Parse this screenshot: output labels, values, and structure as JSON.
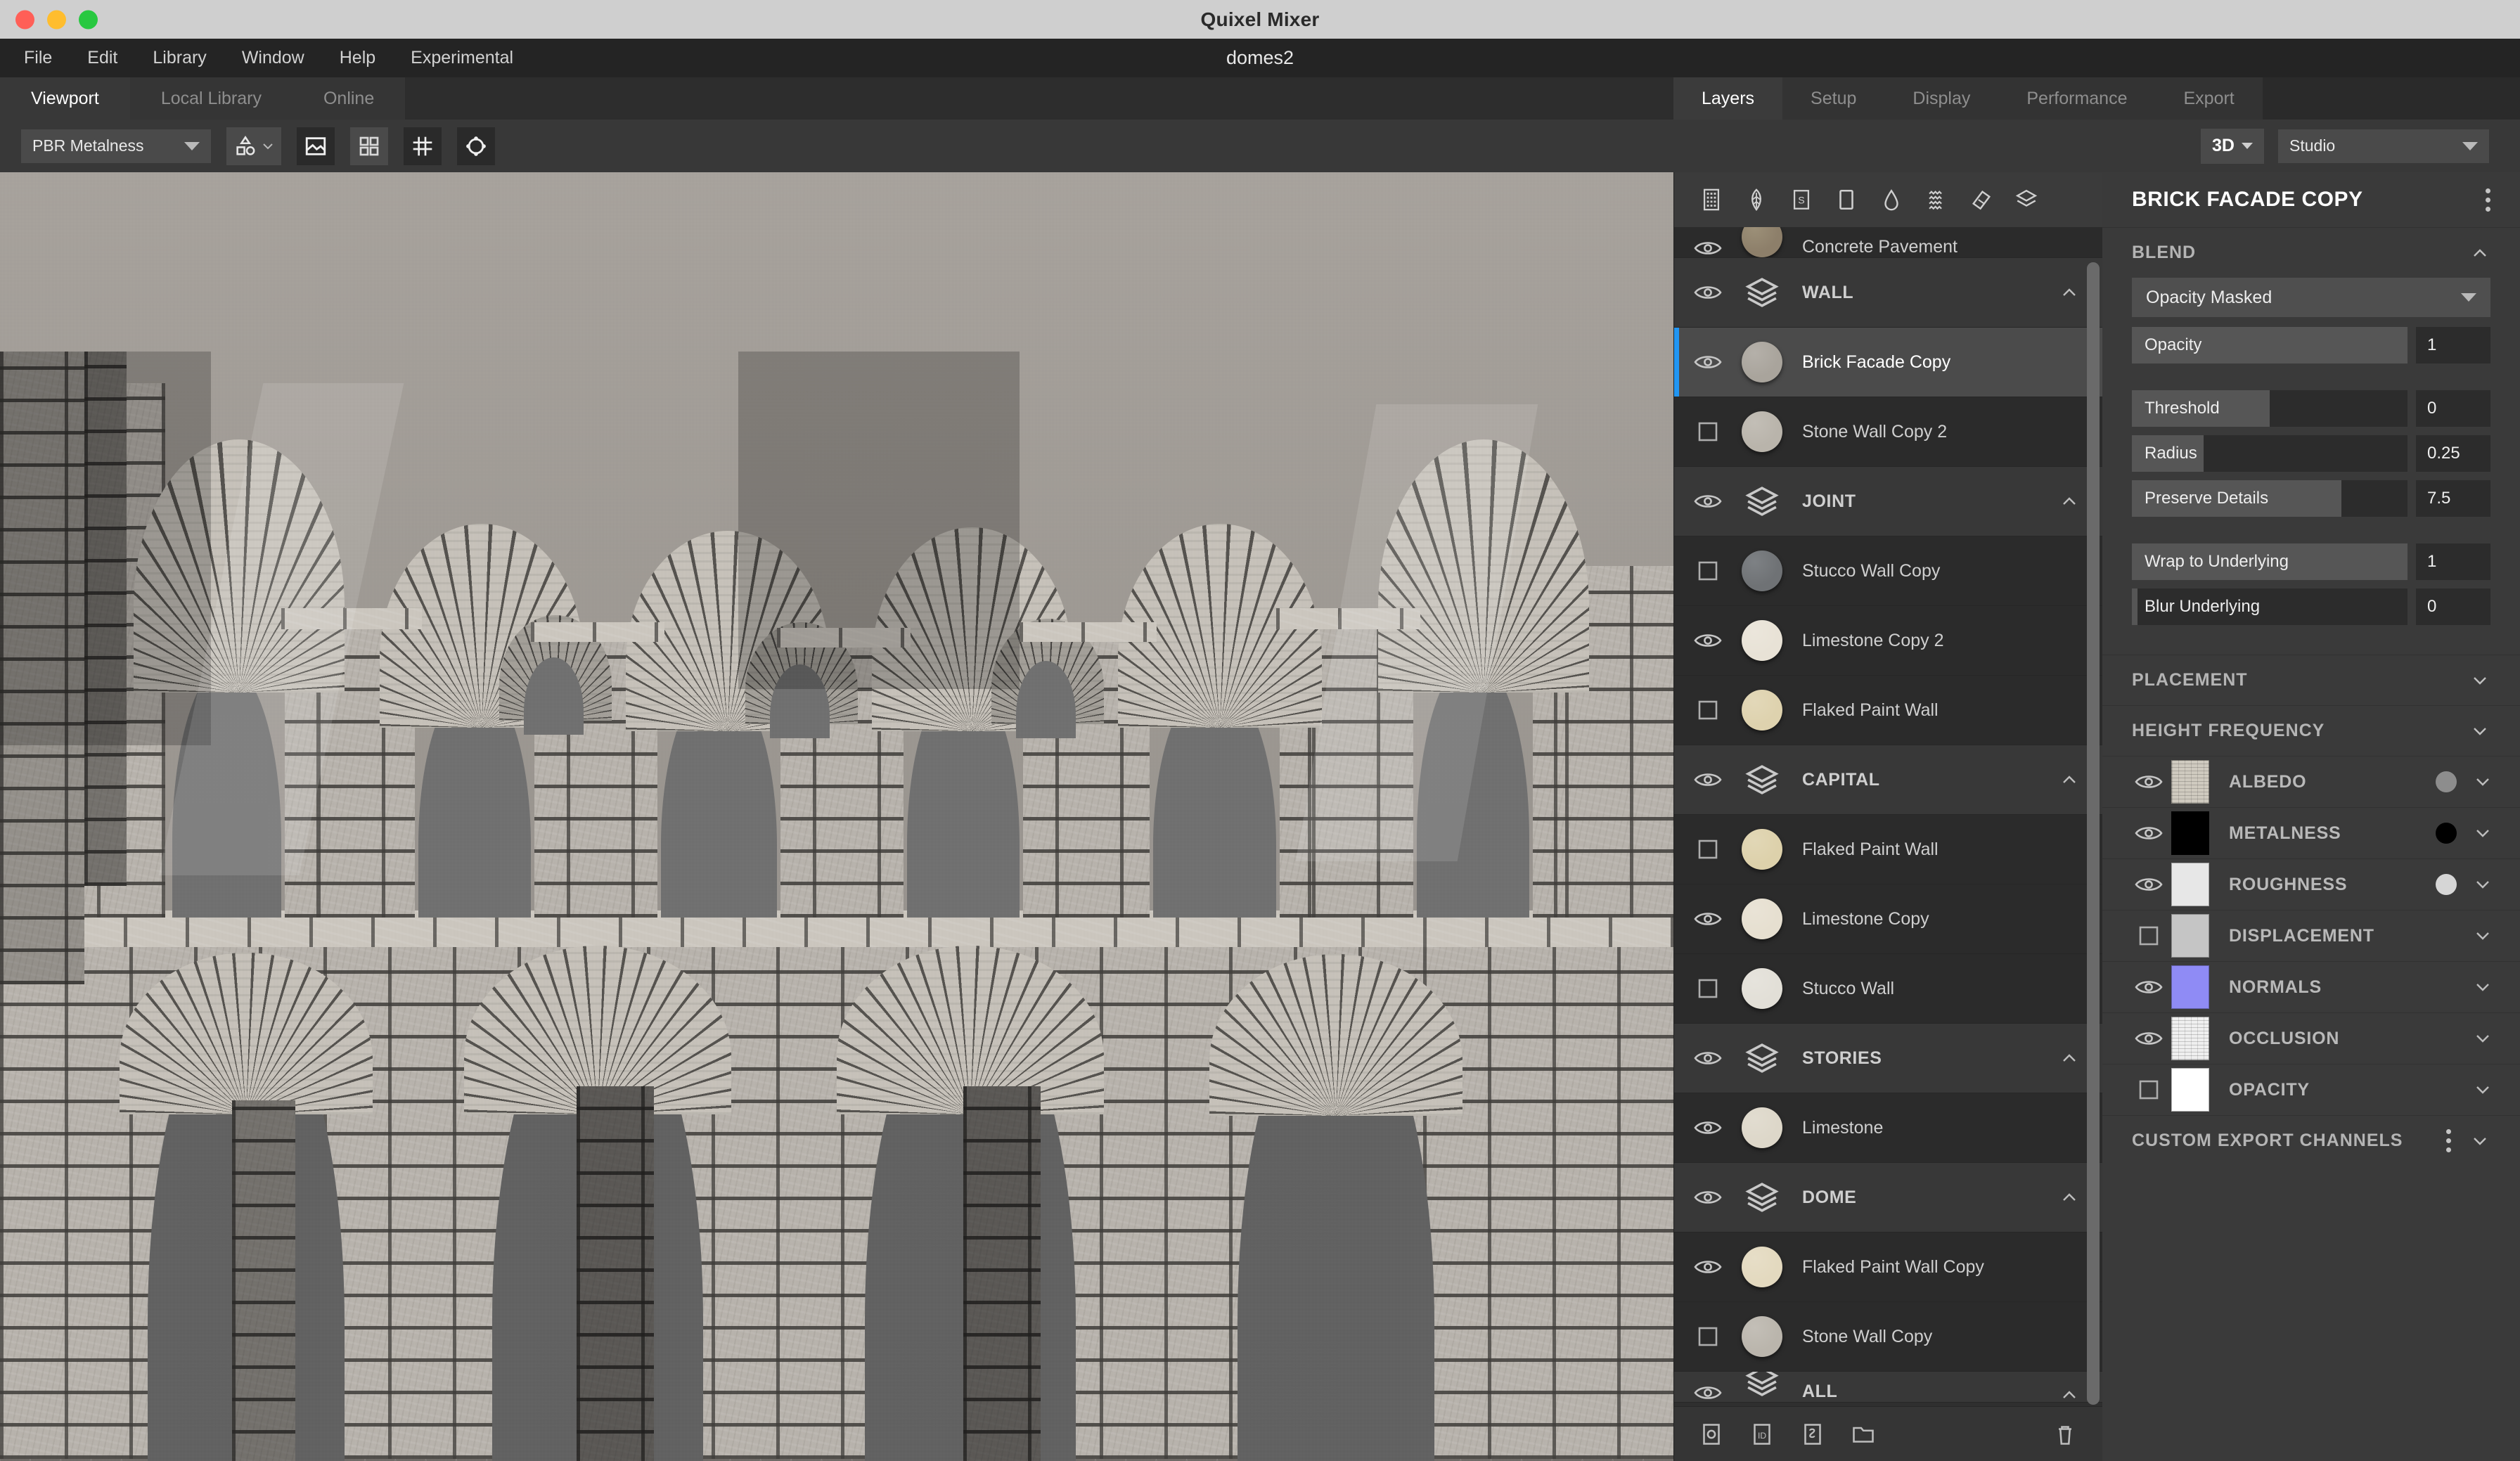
{
  "window": {
    "app_title": "Quixel Mixer",
    "document_title": "domes2"
  },
  "menu": {
    "items": [
      "File",
      "Edit",
      "Library",
      "Window",
      "Help",
      "Experimental"
    ]
  },
  "main_tabs": [
    {
      "label": "Viewport",
      "active": true
    },
    {
      "label": "Local Library",
      "active": false
    },
    {
      "label": "Online",
      "active": false
    }
  ],
  "toolbar": {
    "shading_model": "PBR Metalness",
    "shape_tool_icon": "primitive-shapes-icon",
    "buttons": [
      {
        "icon": "image-icon",
        "active": false
      },
      {
        "icon": "grid-quad-icon",
        "active": true
      },
      {
        "icon": "wireframe-grid-icon",
        "active": false
      },
      {
        "icon": "pivot-target-icon",
        "active": false
      }
    ],
    "view_mode": "3D",
    "environment": "Studio"
  },
  "right_tabs": [
    {
      "label": "Layers",
      "active": true
    },
    {
      "label": "Setup",
      "active": false
    },
    {
      "label": "Display",
      "active": false
    },
    {
      "label": "Performance",
      "active": false
    },
    {
      "label": "Export",
      "active": false
    }
  ],
  "layer_toolbar_icons": [
    "brick-pattern-icon",
    "leaf-icon",
    "surface-s-icon",
    "plane-icon",
    "drop-icon",
    "waves-icon",
    "paint-icon",
    "layers-stack-icon"
  ],
  "layers": [
    {
      "type": "material",
      "name": "Concrete Pavement",
      "visible": true,
      "selected": false,
      "partial": true,
      "thumb": "#8d7f6a"
    },
    {
      "type": "group",
      "name": "WALL",
      "visible": true,
      "selected": false,
      "collapsed": false
    },
    {
      "type": "material",
      "name": "Brick Facade Copy",
      "visible": true,
      "selected": true,
      "thumb": "#a9a49c"
    },
    {
      "type": "material",
      "name": "Stone Wall Copy 2",
      "visible": false,
      "selected": false,
      "thumb": "#b9b4ab"
    },
    {
      "type": "group",
      "name": "JOINT",
      "visible": true,
      "selected": false,
      "collapsed": false
    },
    {
      "type": "material",
      "name": "Stucco Wall Copy",
      "visible": false,
      "selected": false,
      "thumb": "#6f7275"
    },
    {
      "type": "material",
      "name": "Limestone Copy 2",
      "visible": true,
      "selected": false,
      "thumb": "#e8e2d6"
    },
    {
      "type": "material",
      "name": "Flaked Paint Wall",
      "visible": false,
      "selected": false,
      "thumb": "#ded2ae"
    },
    {
      "type": "group",
      "name": "CAPITAL",
      "visible": true,
      "selected": false,
      "collapsed": false
    },
    {
      "type": "material",
      "name": "Flaked Paint Wall",
      "visible": false,
      "selected": false,
      "thumb": "#ddd1ab"
    },
    {
      "type": "material",
      "name": "Limestone Copy",
      "visible": true,
      "selected": false,
      "thumb": "#e6dfd0"
    },
    {
      "type": "material",
      "name": "Stucco Wall",
      "visible": false,
      "selected": false,
      "thumb": "#e2dfd7"
    },
    {
      "type": "group",
      "name": "STORIES",
      "visible": true,
      "selected": false,
      "collapsed": false
    },
    {
      "type": "material",
      "name": "Limestone",
      "visible": true,
      "selected": false,
      "thumb": "#ddd7c9"
    },
    {
      "type": "group",
      "name": "DOME",
      "visible": true,
      "selected": false,
      "collapsed": false
    },
    {
      "type": "material",
      "name": "Flaked Paint Wall Copy",
      "visible": true,
      "selected": false,
      "thumb": "#e3d9bf"
    },
    {
      "type": "material",
      "name": "Stone Wall Copy",
      "visible": false,
      "selected": false,
      "thumb": "#bab5ac"
    },
    {
      "type": "group",
      "name": "ALL",
      "visible": true,
      "selected": false,
      "collapsed": false,
      "partial": true
    }
  ],
  "layer_footer_icons": [
    "add-solid-layer-icon",
    "add-id-layer-icon",
    "add-smart-material-icon",
    "add-group-folder-icon",
    "delete-layer-icon"
  ],
  "properties": {
    "title": "BRICK FACADE COPY",
    "sections": [
      {
        "key": "blend",
        "label": "BLEND",
        "expanded": true
      },
      {
        "key": "placement",
        "label": "PLACEMENT",
        "expanded": false
      },
      {
        "key": "height_frequency",
        "label": "HEIGHT FREQUENCY",
        "expanded": false
      }
    ],
    "blend": {
      "mode": "Opacity Masked",
      "opacity": {
        "label": "Opacity",
        "value": "1",
        "fill_pct": 100
      },
      "threshold": {
        "label": "Threshold",
        "value": "0",
        "fill_pct": 50
      },
      "radius": {
        "label": "Radius",
        "value": "0.25",
        "fill_pct": 26
      },
      "preserve_details": {
        "label": "Preserve Details",
        "value": "7.5",
        "fill_pct": 76
      },
      "wrap_to_underlying": {
        "label": "Wrap to Underlying",
        "value": "1",
        "fill_pct": 100
      },
      "blur_underlying": {
        "label": "Blur Underlying",
        "value": "0",
        "fill_pct": 2
      }
    },
    "channels": [
      {
        "name": "ALBEDO",
        "visible": true,
        "thumb": "#cfcabf",
        "dot": "#8d8d8d",
        "has_dot": true
      },
      {
        "name": "METALNESS",
        "visible": true,
        "thumb": "#000000",
        "dot": "#000000",
        "has_dot": true
      },
      {
        "name": "ROUGHNESS",
        "visible": true,
        "thumb": "#e7e7e7",
        "dot": "#d6d6d6",
        "has_dot": true
      },
      {
        "name": "DISPLACEMENT",
        "visible": false,
        "thumb": "#c5c5c5",
        "dot": "",
        "has_dot": false
      },
      {
        "name": "NORMALS",
        "visible": true,
        "thumb": "#8f8bf5",
        "dot": "",
        "has_dot": false
      },
      {
        "name": "OCCLUSION",
        "visible": true,
        "thumb": "#efefef",
        "dot": "",
        "has_dot": false
      },
      {
        "name": "OPACITY",
        "visible": false,
        "thumb": "#ffffff",
        "dot": "",
        "has_dot": false
      }
    ],
    "custom_export": {
      "label": "CUSTOM EXPORT CHANNELS"
    }
  },
  "colors": {
    "accent_selection": "#2196f3",
    "panel_bg": "#3a3a3a",
    "layer_bg": "#2f2f2f",
    "titlebar": "#cfcfcf"
  }
}
